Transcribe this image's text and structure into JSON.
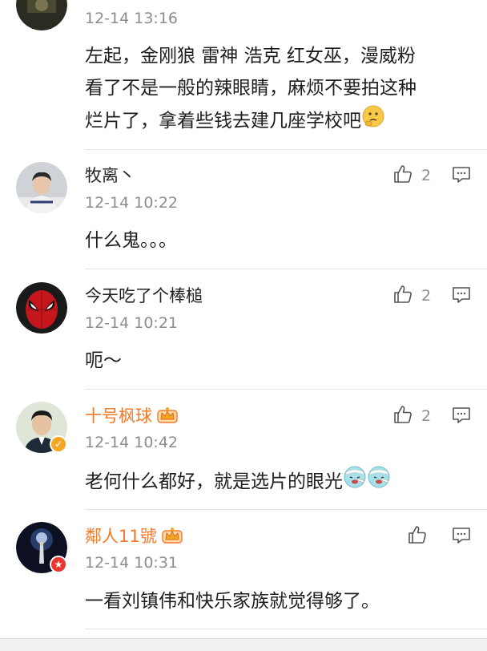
{
  "comments": [
    {
      "user": "",
      "time": "12-14 13:16",
      "text_lines": [
        "左起，金刚狼 雷神 浩克 红女巫，漫威粉",
        "看了不是一般的辣眼睛，麻烦不要拍这种",
        "烂片了，拿着些钱去建几座学校吧"
      ],
      "emoji": "thinking-face-emoji"
    },
    {
      "user": "牧离丶",
      "time": "12-14 10:22",
      "text": "什么鬼。。。",
      "likes": "2"
    },
    {
      "user": "今天吃了个棒槌",
      "time": "12-14 10:21",
      "text": "呃～",
      "likes": "2"
    },
    {
      "user": "十号枫球",
      "time": "12-14 10:42",
      "text": "老何什么都好，就是选片的眼光",
      "likes": "2",
      "vip": true,
      "emoji": "sick-face-emoji"
    },
    {
      "user": "鄰人11號",
      "time": "12-14 10:31",
      "text": "一看刘镇伟和快乐家族就觉得够了。",
      "likes": "",
      "vip": true
    }
  ],
  "colors": {
    "vip_name": "#f07a2a",
    "meta_gray": "#8d8d8d",
    "divider": "#e6e6e6",
    "verified_yellow": "#f5a623",
    "verified_red": "#e8352f"
  },
  "icons": {
    "like": "thumbs-up-icon",
    "reply": "comment-icon",
    "member": "crown-icon"
  }
}
